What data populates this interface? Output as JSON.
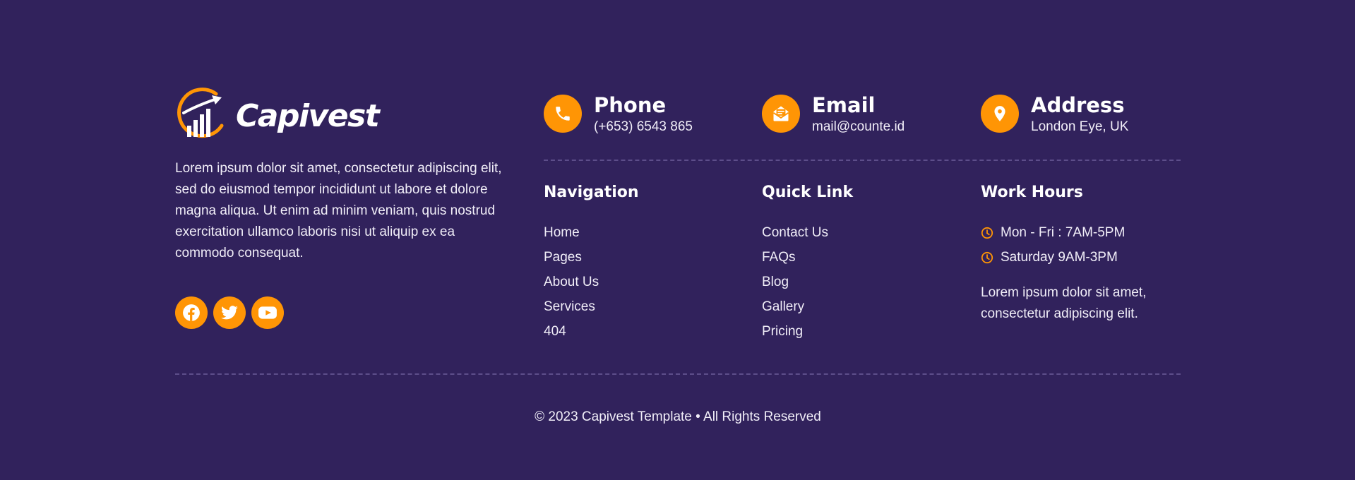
{
  "brand": {
    "name": "Capivest",
    "description": "Lorem ipsum dolor sit amet, consectetur adipiscing elit, sed do eiusmod tempor incididunt ut labore et dolore magna aliqua. Ut enim ad minim veniam, quis nostrud exercitation ullamco laboris nisi ut aliquip ex ea commodo consequat.",
    "socials": [
      {
        "icon": "facebook-icon"
      },
      {
        "icon": "twitter-icon"
      },
      {
        "icon": "youtube-icon"
      }
    ]
  },
  "contacts": [
    {
      "title": "Phone",
      "value": "(+653) 6543 865",
      "icon": "phone-icon"
    },
    {
      "title": "Email",
      "value": "mail@counte.id",
      "icon": "email-icon"
    },
    {
      "title": "Address",
      "value": "London Eye, UK",
      "icon": "location-pin-icon"
    }
  ],
  "navigation": {
    "title": "Navigation",
    "items": [
      "Home",
      "Pages",
      "About Us",
      "Services",
      "404"
    ]
  },
  "quick_link": {
    "title": "Quick Link",
    "items": [
      "Contact Us",
      "FAQs",
      "Blog",
      "Gallery",
      "Pricing"
    ]
  },
  "work_hours": {
    "title": "Work Hours",
    "items": [
      "Mon - Fri : 7AM-5PM",
      "Saturday 9AM-3PM"
    ],
    "note": "Lorem ipsum dolor sit amet, consectetur adipiscing elit."
  },
  "copyright": "© 2023 Capivest Template • All Rights Reserved",
  "colors": {
    "background": "#31225c",
    "accent": "#ff9505",
    "text": "#ffffff",
    "divider": "#5d4e8a"
  }
}
